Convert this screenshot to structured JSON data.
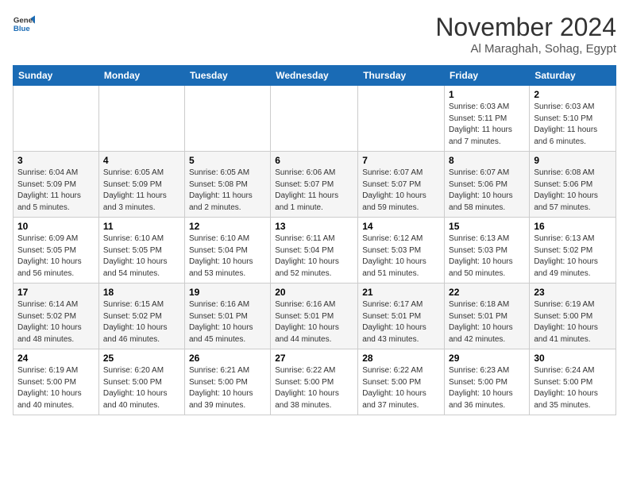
{
  "logo": {
    "line1": "General",
    "line2": "Blue"
  },
  "title": "November 2024",
  "subtitle": "Al Maraghah, Sohag, Egypt",
  "weekdays": [
    "Sunday",
    "Monday",
    "Tuesday",
    "Wednesday",
    "Thursday",
    "Friday",
    "Saturday"
  ],
  "weeks": [
    [
      {
        "day": "",
        "info": ""
      },
      {
        "day": "",
        "info": ""
      },
      {
        "day": "",
        "info": ""
      },
      {
        "day": "",
        "info": ""
      },
      {
        "day": "",
        "info": ""
      },
      {
        "day": "1",
        "info": "Sunrise: 6:03 AM\nSunset: 5:11 PM\nDaylight: 11 hours\nand 7 minutes."
      },
      {
        "day": "2",
        "info": "Sunrise: 6:03 AM\nSunset: 5:10 PM\nDaylight: 11 hours\nand 6 minutes."
      }
    ],
    [
      {
        "day": "3",
        "info": "Sunrise: 6:04 AM\nSunset: 5:09 PM\nDaylight: 11 hours\nand 5 minutes."
      },
      {
        "day": "4",
        "info": "Sunrise: 6:05 AM\nSunset: 5:09 PM\nDaylight: 11 hours\nand 3 minutes."
      },
      {
        "day": "5",
        "info": "Sunrise: 6:05 AM\nSunset: 5:08 PM\nDaylight: 11 hours\nand 2 minutes."
      },
      {
        "day": "6",
        "info": "Sunrise: 6:06 AM\nSunset: 5:07 PM\nDaylight: 11 hours\nand 1 minute."
      },
      {
        "day": "7",
        "info": "Sunrise: 6:07 AM\nSunset: 5:07 PM\nDaylight: 10 hours\nand 59 minutes."
      },
      {
        "day": "8",
        "info": "Sunrise: 6:07 AM\nSunset: 5:06 PM\nDaylight: 10 hours\nand 58 minutes."
      },
      {
        "day": "9",
        "info": "Sunrise: 6:08 AM\nSunset: 5:06 PM\nDaylight: 10 hours\nand 57 minutes."
      }
    ],
    [
      {
        "day": "10",
        "info": "Sunrise: 6:09 AM\nSunset: 5:05 PM\nDaylight: 10 hours\nand 56 minutes."
      },
      {
        "day": "11",
        "info": "Sunrise: 6:10 AM\nSunset: 5:05 PM\nDaylight: 10 hours\nand 54 minutes."
      },
      {
        "day": "12",
        "info": "Sunrise: 6:10 AM\nSunset: 5:04 PM\nDaylight: 10 hours\nand 53 minutes."
      },
      {
        "day": "13",
        "info": "Sunrise: 6:11 AM\nSunset: 5:04 PM\nDaylight: 10 hours\nand 52 minutes."
      },
      {
        "day": "14",
        "info": "Sunrise: 6:12 AM\nSunset: 5:03 PM\nDaylight: 10 hours\nand 51 minutes."
      },
      {
        "day": "15",
        "info": "Sunrise: 6:13 AM\nSunset: 5:03 PM\nDaylight: 10 hours\nand 50 minutes."
      },
      {
        "day": "16",
        "info": "Sunrise: 6:13 AM\nSunset: 5:02 PM\nDaylight: 10 hours\nand 49 minutes."
      }
    ],
    [
      {
        "day": "17",
        "info": "Sunrise: 6:14 AM\nSunset: 5:02 PM\nDaylight: 10 hours\nand 48 minutes."
      },
      {
        "day": "18",
        "info": "Sunrise: 6:15 AM\nSunset: 5:02 PM\nDaylight: 10 hours\nand 46 minutes."
      },
      {
        "day": "19",
        "info": "Sunrise: 6:16 AM\nSunset: 5:01 PM\nDaylight: 10 hours\nand 45 minutes."
      },
      {
        "day": "20",
        "info": "Sunrise: 6:16 AM\nSunset: 5:01 PM\nDaylight: 10 hours\nand 44 minutes."
      },
      {
        "day": "21",
        "info": "Sunrise: 6:17 AM\nSunset: 5:01 PM\nDaylight: 10 hours\nand 43 minutes."
      },
      {
        "day": "22",
        "info": "Sunrise: 6:18 AM\nSunset: 5:01 PM\nDaylight: 10 hours\nand 42 minutes."
      },
      {
        "day": "23",
        "info": "Sunrise: 6:19 AM\nSunset: 5:00 PM\nDaylight: 10 hours\nand 41 minutes."
      }
    ],
    [
      {
        "day": "24",
        "info": "Sunrise: 6:19 AM\nSunset: 5:00 PM\nDaylight: 10 hours\nand 40 minutes."
      },
      {
        "day": "25",
        "info": "Sunrise: 6:20 AM\nSunset: 5:00 PM\nDaylight: 10 hours\nand 40 minutes."
      },
      {
        "day": "26",
        "info": "Sunrise: 6:21 AM\nSunset: 5:00 PM\nDaylight: 10 hours\nand 39 minutes."
      },
      {
        "day": "27",
        "info": "Sunrise: 6:22 AM\nSunset: 5:00 PM\nDaylight: 10 hours\nand 38 minutes."
      },
      {
        "day": "28",
        "info": "Sunrise: 6:22 AM\nSunset: 5:00 PM\nDaylight: 10 hours\nand 37 minutes."
      },
      {
        "day": "29",
        "info": "Sunrise: 6:23 AM\nSunset: 5:00 PM\nDaylight: 10 hours\nand 36 minutes."
      },
      {
        "day": "30",
        "info": "Sunrise: 6:24 AM\nSunset: 5:00 PM\nDaylight: 10 hours\nand 35 minutes."
      }
    ]
  ]
}
